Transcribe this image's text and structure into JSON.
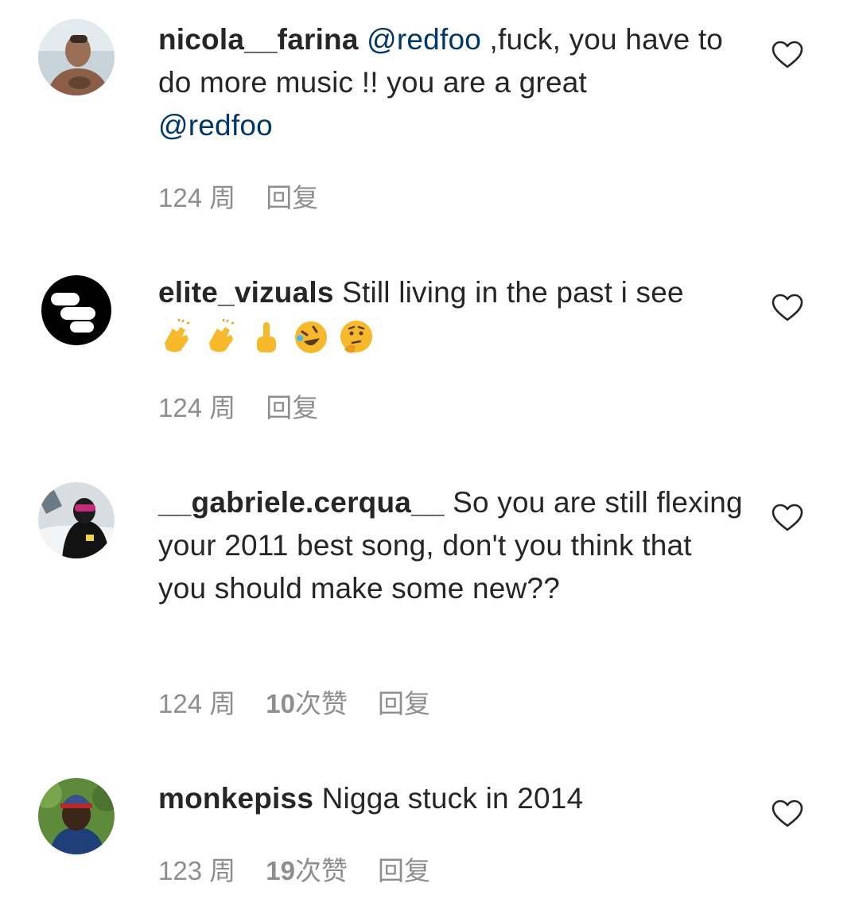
{
  "comments": [
    {
      "username": "nicola__farina",
      "mention": "@redfoo",
      "text": " ,fuck, you have to do more music !! you are a great ",
      "mention2": "@redfoo",
      "time": "124 周",
      "likes": "",
      "likes_unit": "",
      "reply": "回复"
    },
    {
      "username": "elite_vizuals",
      "text": " Still living in the past i see",
      "emojis": [
        "clapping-hands",
        "clapping-hands",
        "middle-finger",
        "rolling-on-floor-laughing",
        "thinking-face"
      ],
      "time": "124 周",
      "likes": "",
      "likes_unit": "",
      "reply": "回复"
    },
    {
      "username": "__gabriele.cerqua__",
      "text": " So you are still flexing your 2011 best song, don't you think that you should make some new??",
      "time": "124 周",
      "likes": "10",
      "likes_unit": " 次赞",
      "reply": "回复"
    },
    {
      "username": "monkepiss",
      "text": " Nigga stuck in 2014",
      "time": "123 周",
      "likes": "19",
      "likes_unit": " 次赞",
      "reply": "回复"
    }
  ],
  "icons": {
    "like": "heart-outline-icon"
  },
  "colors": {
    "text": "#262626",
    "mention": "#00376b",
    "meta": "#8e8e8e"
  }
}
